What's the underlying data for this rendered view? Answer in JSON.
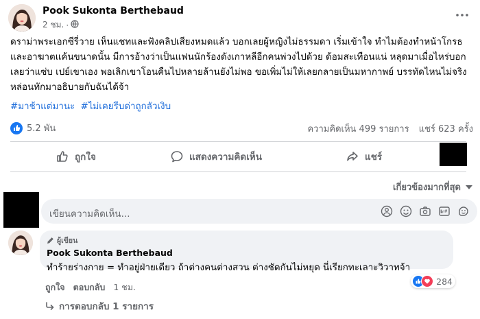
{
  "post": {
    "author": "Pook Sukonta Berthebaud",
    "time": "2 ชม.",
    "dot": "·",
    "body": "ดราม่าพระเอกซีรี่วาย เห็นแชทและฟังคลิปเสียงหมดแล้ว บอกเลยผู้หญิงไม่ธรรมดา เริ่มเข้าใจ ทำไมต้องทำหน้าโกรธและอาฆาตแค้นขนาดนั้น มีการอ้างว่าเป็นแฟนนักร้องดังเกาหลีอีกคนพ่วงไปด้วย ด้อมสะเทือนแน่ หลุดมาเมื่อไหร่บอกเลยว่าแซ่บ เปย์เขาเอง พอเลิกเขาโอนคืนไปหลายล้านยังไม่พอ ขอเพิ่มไม่ให้เลยกลายเป็นมหากาพย์ บรรทัดไหนไม่จริง หล่อนทักมาอธิบายกับฉันได้จ้า",
    "hashtags": [
      "#มาช้าแต่มานะ",
      "#ไม่เคยรีบด่าถูกลัวเงิบ"
    ]
  },
  "stats": {
    "likes": "5.2 พัน",
    "comments": "ความคิดเห็น 499 รายการ",
    "shares": "แชร์ 623 ครั้ง"
  },
  "actions": {
    "like": "ถูกใจ",
    "comment": "แสดงความคิดเห็น",
    "share": "แชร์"
  },
  "sort": {
    "label": "เกี่ยวข้องมากที่สุด"
  },
  "comment_input": {
    "placeholder": "เขียนความคิดเห็น..."
  },
  "comment": {
    "badge": "ผู้เขียน",
    "author": "Pook Sukonta Berthebaud",
    "text": "ทำร้ายร่างกาย = ทำอยู่ฝ่ายเดียว ถ้าต่างคนต่างสวน ต่างชัดกันไม่หยุด นี่เรียกทะเลาะวิวาทจ้า",
    "like": "ถูกใจ",
    "reply": "ตอบกลับ",
    "time": "1 ชม.",
    "reactions": "284",
    "replies": "การตอบกลับ 1 รายการ"
  },
  "colors": {
    "accent": "#216fdb",
    "like_blue": "#1877f2",
    "love_red": "#f33e58",
    "muted": "#65676b",
    "bubble": "#f0f2f5"
  }
}
